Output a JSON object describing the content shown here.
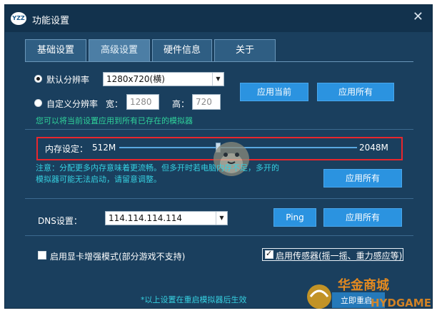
{
  "window": {
    "logo": "YZZ",
    "title": "功能设置",
    "close_glyph": "✕"
  },
  "tabs": [
    {
      "label": "基础设置",
      "active": false
    },
    {
      "label": "高级设置",
      "active": true
    },
    {
      "label": "硬件信息",
      "active": false
    },
    {
      "label": "关于",
      "active": false
    }
  ],
  "resolution": {
    "default_label": "默认分辨率",
    "default_value": "1280x720(横)",
    "custom_label": "自定义分辨率",
    "width_label": "宽：",
    "width_value": "1280",
    "height_label": "高：",
    "height_value": "720",
    "apply_current": "应用当前",
    "apply_all": "应用所有",
    "hint": "您可以将当前设置应用到所有已存在的模拟器"
  },
  "memory": {
    "label": "内存设定：",
    "min": "512M",
    "max": "2048M",
    "note_line1": "注意：分配更多内存意味着更流畅。但多开时若电脑内存不足，多开的",
    "note_line2": "模拟器可能无法启动，请留意调整。",
    "apply_all": "应用所有"
  },
  "dns": {
    "label": "DNS设置：",
    "value": "114.114.114.114",
    "ping": "Ping",
    "apply_all": "应用所有"
  },
  "gpu_enhance": {
    "label": "启用显卡增强模式(部分游戏不支持)",
    "checked": false
  },
  "sensor": {
    "label": "启用传感器(摇一摇、重力感应等)",
    "checked": true
  },
  "footer_note": "*以上设置在重启模拟器后生效",
  "watermark": {
    "line1": "华金商城",
    "line2": "HYDGAME",
    "partial_button": "立即重启"
  },
  "colors": {
    "window_bg": "#1a3f5e",
    "titlebar_bg": "#12324d",
    "button_bg": "#2b93e0",
    "hint_green": "#2fd29a",
    "note_cyan": "#36d0e0",
    "highlight_red": "#e8262d"
  },
  "icons": {
    "close": "close-icon",
    "logo": "app-logo-icon",
    "select_arrow": "triangle-down-icon"
  }
}
